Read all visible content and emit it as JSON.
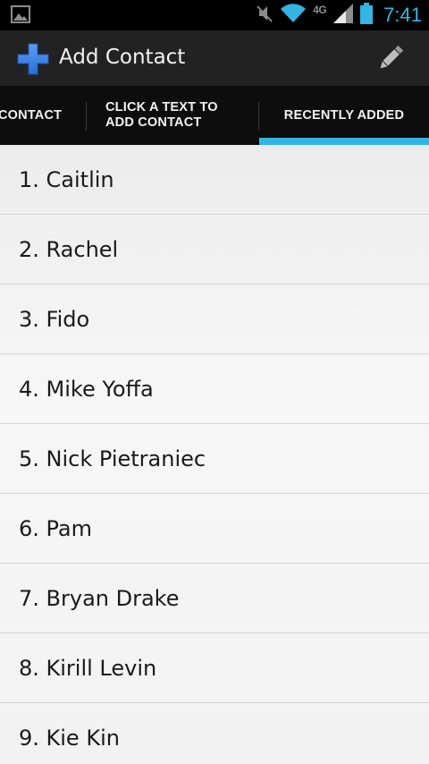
{
  "status_bar": {
    "time": "7:41",
    "network": "4G",
    "icons": [
      "image-notification-icon",
      "mute-icon",
      "wifi-icon",
      "signal-icon",
      "battery-icon"
    ],
    "accent_color": "#33b5e5"
  },
  "action_bar": {
    "title": "Add Contact",
    "app_icon": "plus-icon",
    "action_icon": "pencil-icon"
  },
  "tabs": [
    {
      "label": "CONTACT",
      "selected": false
    },
    {
      "label": "CLICK A TEXT TO ADD CONTACT",
      "selected": false
    },
    {
      "label": "RECENTLY ADDED",
      "selected": true
    }
  ],
  "contacts": [
    "1. Caitlin",
    "2. Rachel",
    "3. Fido",
    "4. Mike Yoffa",
    "5. Nick Pietraniec",
    "6. Pam",
    "7. Bryan Drake",
    "8. Kirill Levin",
    "9. Kie Kin"
  ]
}
